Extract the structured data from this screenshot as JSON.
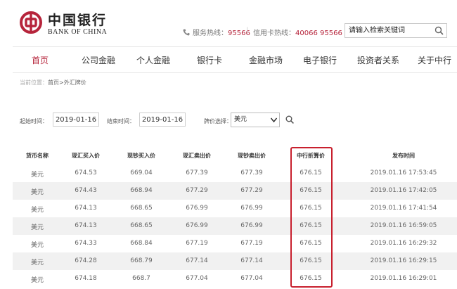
{
  "brand": {
    "name_cn": "中国银行",
    "name_en": "BANK OF CHINA",
    "primary_color": "#b6243b"
  },
  "header": {
    "service_hotline_label": "服务热线：",
    "service_hotline_number": "95566",
    "card_hotline_label": "信用卡热线：",
    "card_hotline_number": "40066 95566",
    "search_placeholder": "请输入检索关键词"
  },
  "nav": {
    "items": [
      {
        "label": "首页",
        "active": true
      },
      {
        "label": "公司金融"
      },
      {
        "label": "个人金融"
      },
      {
        "label": "银行卡"
      },
      {
        "label": "金融市场"
      },
      {
        "label": "电子银行"
      },
      {
        "label": "投资者关系"
      },
      {
        "label": "关于中行"
      }
    ]
  },
  "breadcrumb": {
    "prefix": "当前位置：",
    "path": "首页>外汇牌价"
  },
  "filter": {
    "start_label": "起始时间：",
    "start_value": "2019-01-16",
    "end_label": "结束时间：",
    "end_value": "2019-01-16",
    "currency_label": "牌价选择：",
    "currency_value": "美元"
  },
  "table": {
    "columns": [
      "货币名称",
      "现汇买入价",
      "现钞买入价",
      "现汇卖出价",
      "现钞卖出价",
      "中行折算价",
      "发布时间"
    ],
    "rows": [
      [
        "美元",
        "674.53",
        "669.04",
        "677.39",
        "677.39",
        "676.15",
        "2019.01.16 17:53:45"
      ],
      [
        "美元",
        "674.43",
        "668.94",
        "677.29",
        "677.29",
        "676.15",
        "2019.01.16 17:42:05"
      ],
      [
        "美元",
        "674.13",
        "668.65",
        "676.99",
        "676.99",
        "676.15",
        "2019.01.16 17:41:54"
      ],
      [
        "美元",
        "674.13",
        "668.65",
        "676.99",
        "676.99",
        "676.15",
        "2019.01.16 16:59:05"
      ],
      [
        "美元",
        "674.33",
        "668.84",
        "677.19",
        "677.19",
        "676.15",
        "2019.01.16 16:29:32"
      ],
      [
        "美元",
        "674.28",
        "668.79",
        "677.14",
        "677.14",
        "676.15",
        "2019.01.16 16:29:15"
      ],
      [
        "美元",
        "674.18",
        "668.7",
        "677.04",
        "677.04",
        "676.15",
        "2019.01.16 16:29:01"
      ]
    ],
    "highlighted_column": "中行折算价",
    "highlight_color": "#c8202e"
  },
  "icons": {
    "logo": "boc-logo-icon",
    "phone": "phone-icon",
    "search": "search-icon",
    "dropdown": "chevron-down-icon"
  }
}
